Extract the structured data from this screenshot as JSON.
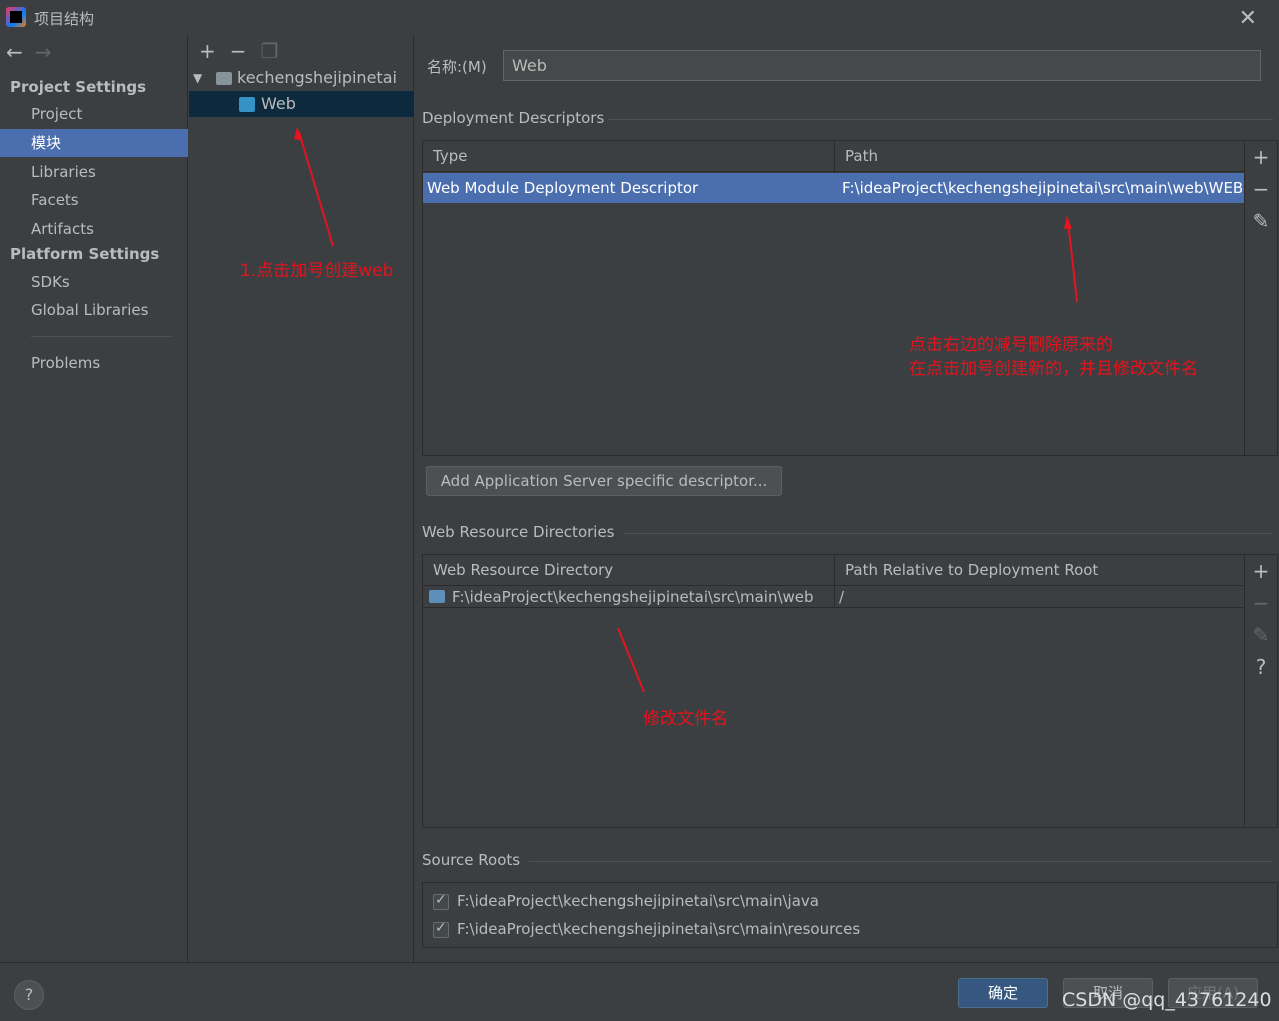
{
  "window": {
    "title": "项目结构"
  },
  "nav": {
    "project_settings": "Project Settings",
    "platform_settings": "Platform Settings",
    "items": [
      {
        "label": "Project"
      },
      {
        "label": "模块"
      },
      {
        "label": "Libraries"
      },
      {
        "label": "Facets"
      },
      {
        "label": "Artifacts"
      },
      {
        "label": "SDKs"
      },
      {
        "label": "Global Libraries"
      },
      {
        "label": "Problems"
      }
    ]
  },
  "tree": {
    "root": "kechengshejipinetai",
    "child": "Web"
  },
  "main": {
    "name_label": "名称:(M)",
    "name_value": "Web",
    "deployment": {
      "title": "Deployment Descriptors",
      "headers": [
        "Type",
        "Path"
      ],
      "rows": [
        {
          "type": "Web Module Deployment Descriptor",
          "path": "F:\\ideaProject\\kechengshejipinetai\\src\\main\\web\\WEB-"
        }
      ],
      "add_server_button": "Add Application Server specific descriptor..."
    },
    "resources": {
      "title": "Web Resource Directories",
      "headers": [
        "Web Resource Directory",
        "Path Relative to Deployment Root"
      ],
      "rows": [
        {
          "dir": "F:\\ideaProject\\kechengshejipinetai\\src\\main\\web",
          "rel": "/"
        }
      ]
    },
    "source_roots": {
      "title": "Source Roots",
      "items": [
        "F:\\ideaProject\\kechengshejipinetai\\src\\main\\java",
        "F:\\ideaProject\\kechengshejipinetai\\src\\main\\resources"
      ]
    }
  },
  "footer": {
    "ok": "确定",
    "cancel": "取消",
    "apply": "应用(A)",
    "watermark": "CSDN @qq_43761240"
  },
  "annotations": {
    "a1": "1.点击加号创建web",
    "a2_line1": "点击右边的减号删除原来的",
    "a2_line2": "在点击加号创建新的，并且修改文件名",
    "a3": "修改文件名"
  },
  "colors": {
    "background": "#3c3f41",
    "selection": "#4b6eaf",
    "tree_selection": "#0d293e",
    "annotation": "#e3141d"
  }
}
